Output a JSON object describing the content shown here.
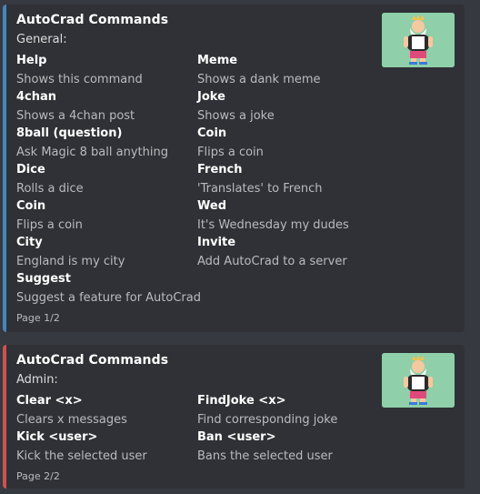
{
  "embeds": [
    {
      "title": "AutoCrad Commands",
      "description": "General:",
      "accent_color": "#3b88c3",
      "thumbnail": "cartoon-king-avatar",
      "fields": [
        {
          "name": "Help",
          "value": "Shows this command"
        },
        {
          "name": "Meme",
          "value": "Shows a dank meme"
        },
        {
          "name": "4chan",
          "value": "Shows a 4chan post"
        },
        {
          "name": "Joke",
          "value": "Shows a joke"
        },
        {
          "name": "8ball (question)",
          "value": "Ask Magic 8 ball anything"
        },
        {
          "name": "Coin",
          "value": "Flips a coin"
        },
        {
          "name": "Dice",
          "value": "Rolls a dice"
        },
        {
          "name": "French",
          "value": "'Translates' to French"
        },
        {
          "name": "Coin",
          "value": "Flips a coin"
        },
        {
          "name": "Wed",
          "value": "It's Wednesday my dudes"
        },
        {
          "name": "City",
          "value": "England is my city"
        },
        {
          "name": "Invite",
          "value": "Add AutoCrad to a server"
        },
        {
          "name": "Suggest",
          "value": "Suggest a feature for AutoCrad"
        }
      ],
      "footer": "Page 1/2"
    },
    {
      "title": "AutoCrad Commands",
      "description": "Admin:",
      "accent_color": "#dd4b4b",
      "thumbnail": "cartoon-king-avatar",
      "fields": [
        {
          "name": "Clear <x>",
          "value": "Clears x messages"
        },
        {
          "name": "FindJoke <x>",
          "value": "Find corresponding joke"
        },
        {
          "name": "Kick <user>",
          "value": "Kick the selected user"
        },
        {
          "name": "Ban <user>",
          "value": "Bans the selected user"
        }
      ],
      "footer": "Page 2/2"
    }
  ]
}
